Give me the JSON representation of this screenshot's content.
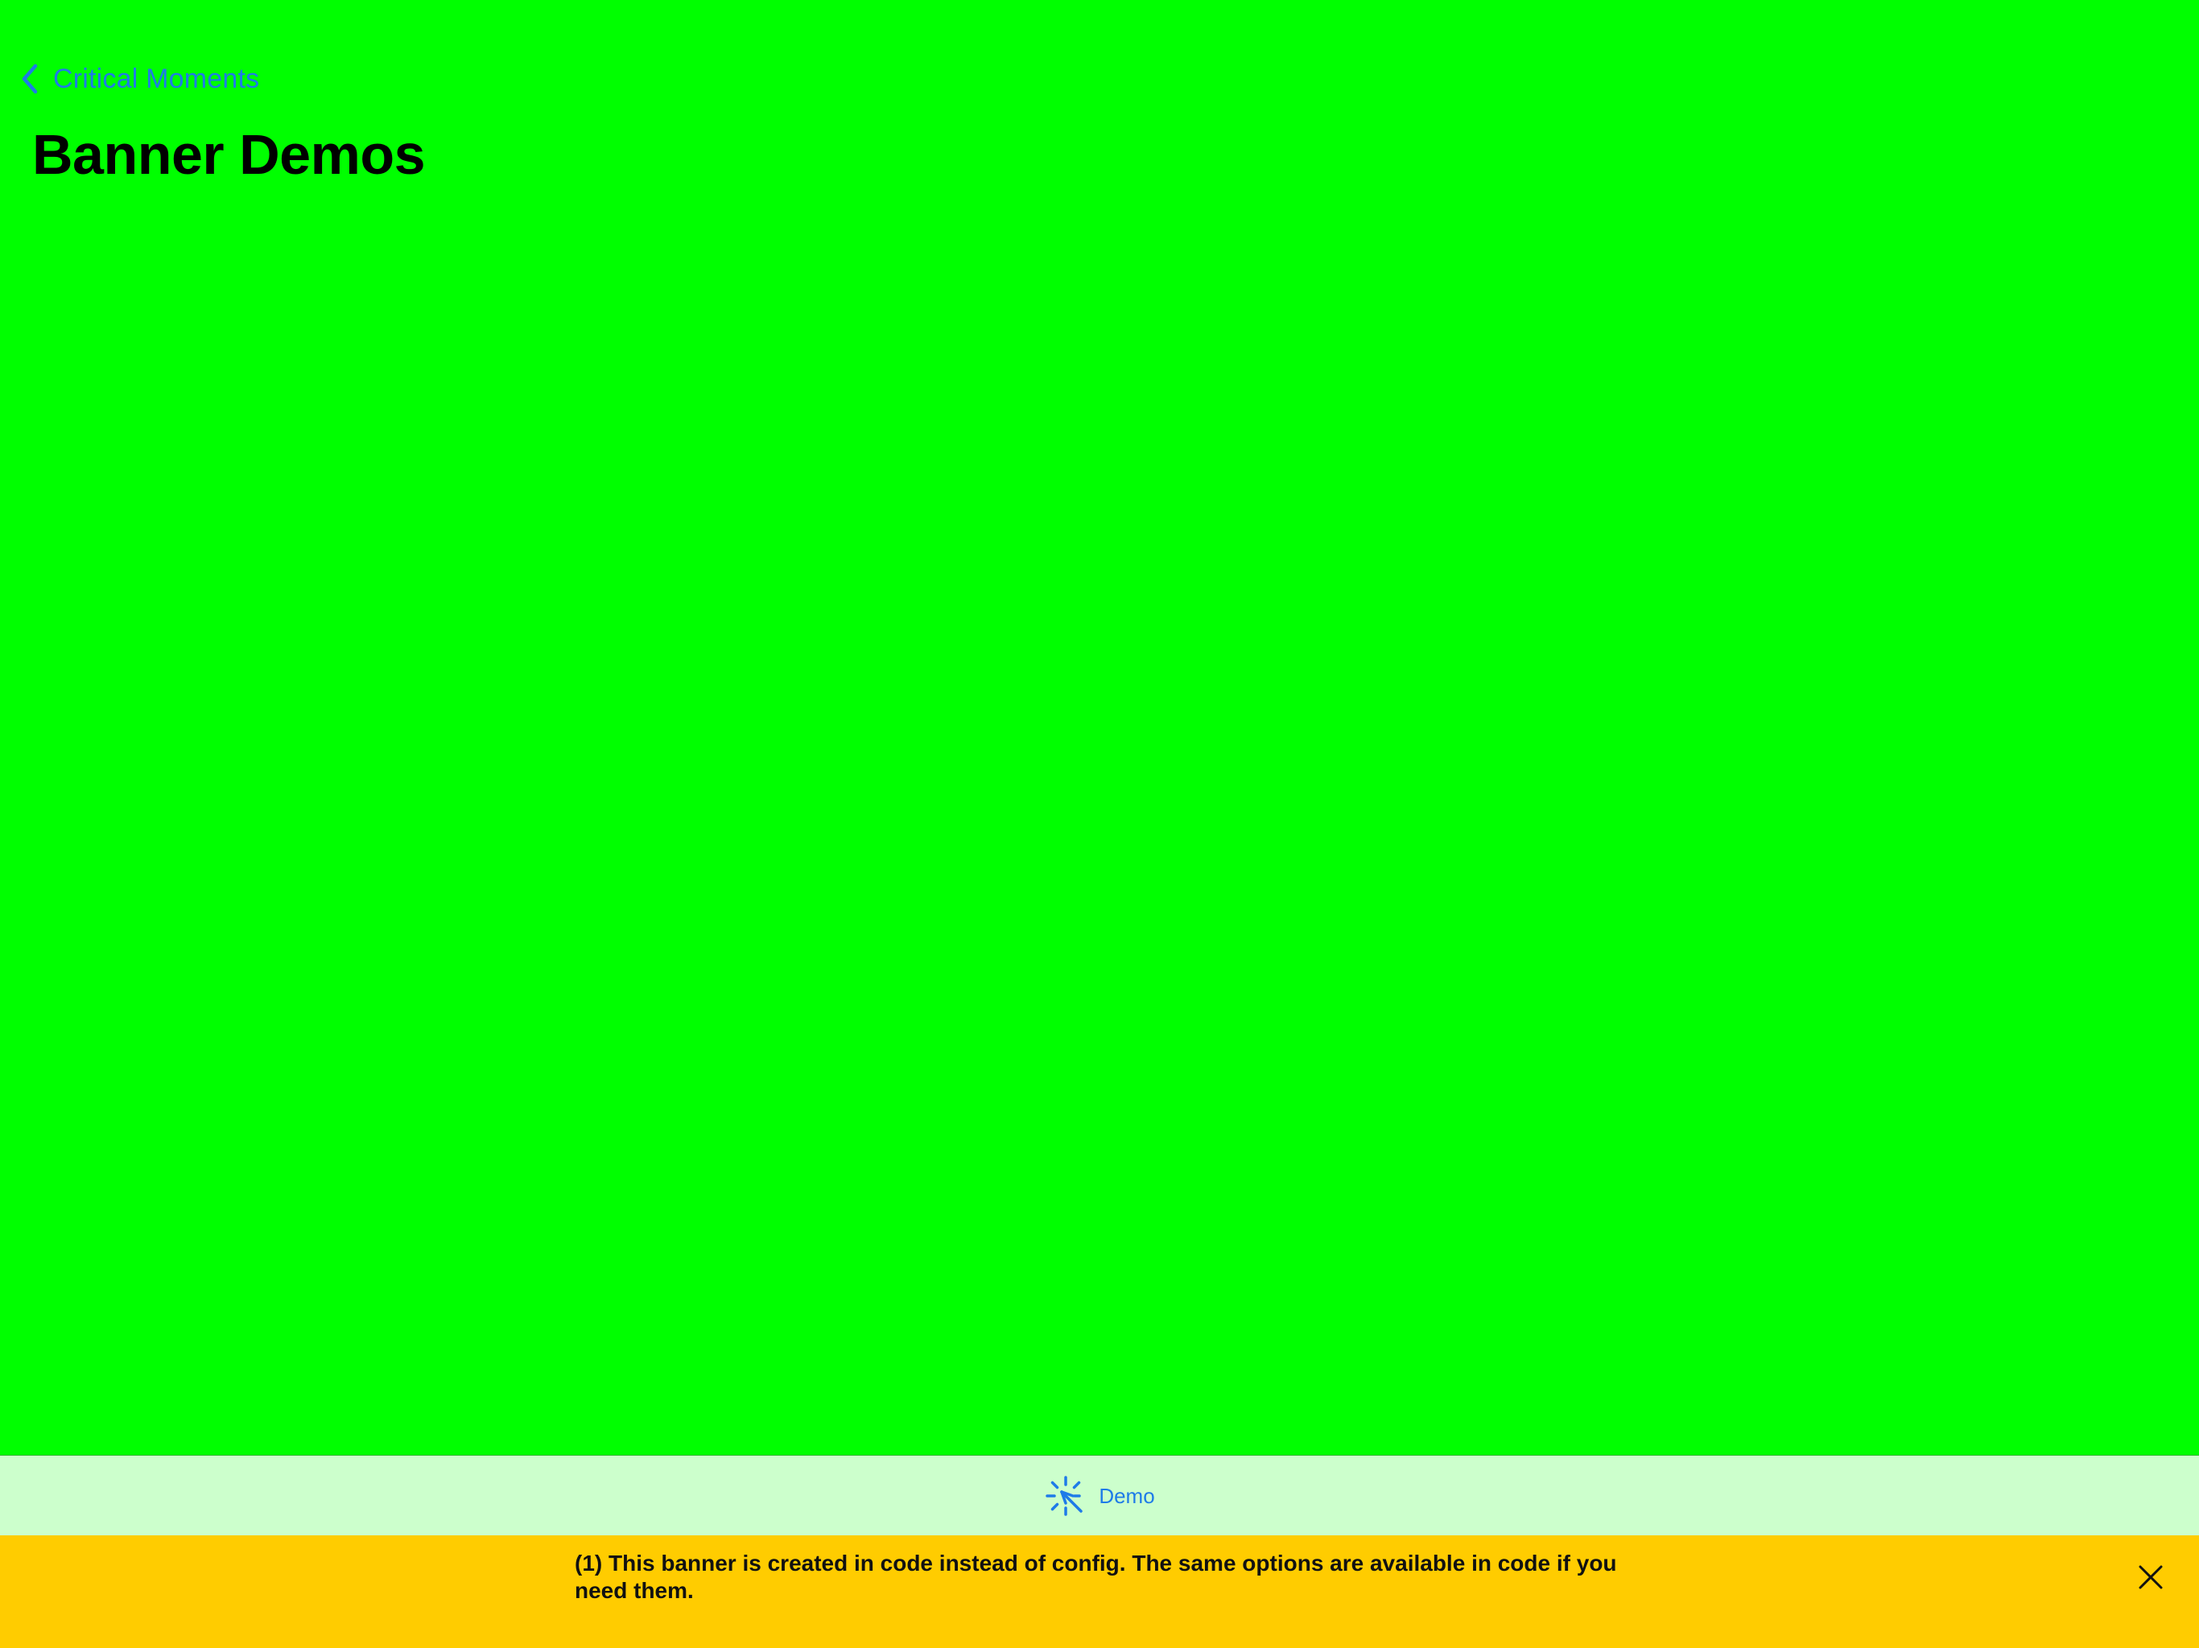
{
  "colors": {
    "background": "#00FF00",
    "accent": "#1E7BE8",
    "tab_bar_background": "#CCFFCC",
    "banner_background": "#FFCC00"
  },
  "nav": {
    "back_label": "Critical Moments",
    "back_icon": "chevron-left-icon"
  },
  "page": {
    "title": "Banner Demos"
  },
  "tab_bar": {
    "items": [
      {
        "label": "Demo",
        "icon": "sparkle-cursor-icon"
      }
    ]
  },
  "banner": {
    "message": "(1) This banner is created in code instead of config. The same options are available in code if you need them.",
    "close_icon": "close-icon"
  }
}
